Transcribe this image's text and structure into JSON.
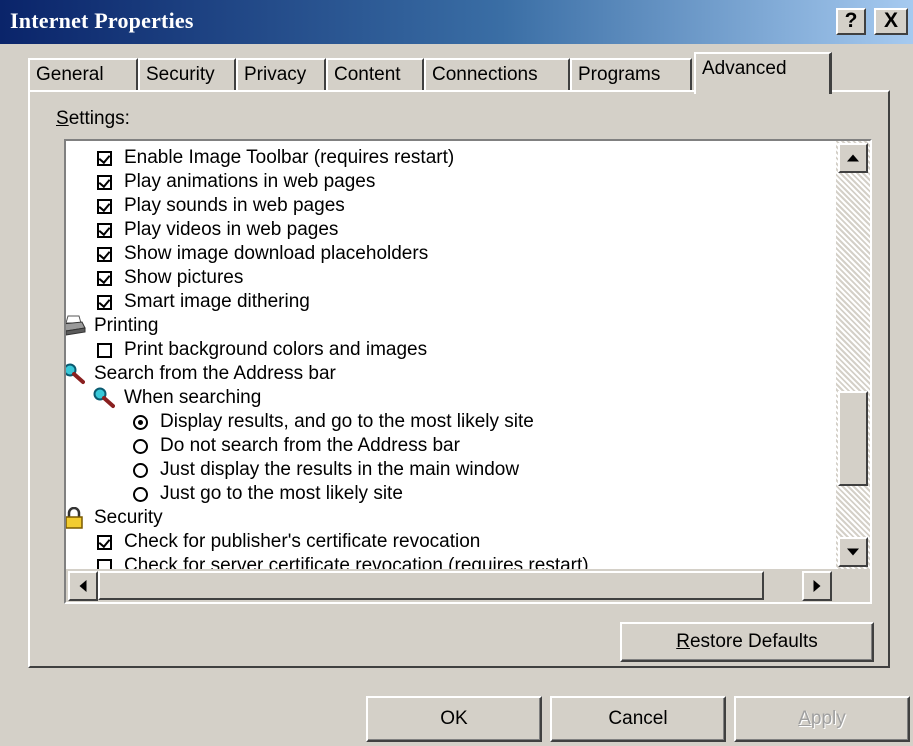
{
  "window": {
    "title": "Internet Properties",
    "help_label": "?",
    "close_label": "X"
  },
  "tabs": [
    {
      "label": "General"
    },
    {
      "label": "Security"
    },
    {
      "label": "Privacy"
    },
    {
      "label": "Content"
    },
    {
      "label": "Connections"
    },
    {
      "label": "Programs"
    },
    {
      "label": "Advanced",
      "active": true
    }
  ],
  "settings": {
    "label_first": "S",
    "label_rest": "ettings:",
    "items": [
      {
        "type": "checkbox",
        "checked": true,
        "text": "Enable Image Toolbar (requires restart)"
      },
      {
        "type": "checkbox",
        "checked": true,
        "text": "Play animations in web pages"
      },
      {
        "type": "checkbox",
        "checked": true,
        "text": "Play sounds in web pages"
      },
      {
        "type": "checkbox",
        "checked": true,
        "text": "Play videos in web pages"
      },
      {
        "type": "checkbox",
        "checked": true,
        "text": "Show image download placeholders"
      },
      {
        "type": "checkbox",
        "checked": true,
        "text": "Show pictures"
      },
      {
        "type": "checkbox",
        "checked": true,
        "text": "Smart image dithering"
      },
      {
        "type": "category",
        "icon": "printer-icon",
        "text": "Printing"
      },
      {
        "type": "checkbox",
        "checked": false,
        "text": "Print background colors and images"
      },
      {
        "type": "category",
        "icon": "magnifier-icon",
        "text": "Search from the Address bar"
      },
      {
        "type": "subcategory",
        "icon": "magnifier-icon",
        "text": "When searching"
      },
      {
        "type": "radio",
        "selected": true,
        "text": "Display results, and go to the most likely site"
      },
      {
        "type": "radio",
        "selected": false,
        "text": "Do not search from the Address bar"
      },
      {
        "type": "radio",
        "selected": false,
        "text": "Just display the results in the main window"
      },
      {
        "type": "radio",
        "selected": false,
        "text": "Just go to the most likely site"
      },
      {
        "type": "category",
        "icon": "lock-icon",
        "text": "Security"
      },
      {
        "type": "checkbox",
        "checked": true,
        "text": "Check for publisher's certificate revocation"
      },
      {
        "type": "checkbox",
        "checked": false,
        "text": "Check for server certificate revocation (requires restart)"
      }
    ]
  },
  "buttons": {
    "restore_first": "R",
    "restore_rest": "estore Defaults",
    "ok": "OK",
    "cancel": "Cancel",
    "apply_first": "A",
    "apply_rest": "pply"
  }
}
